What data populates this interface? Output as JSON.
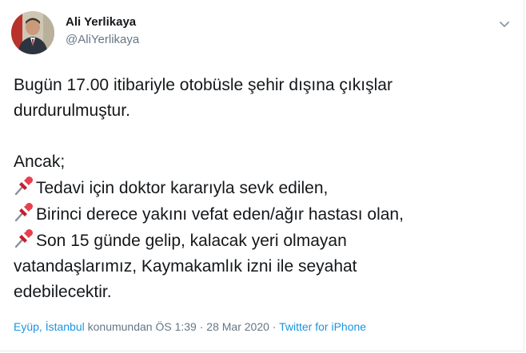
{
  "author": {
    "name": "Ali Yerlikaya",
    "handle": "@AliYerlikaya"
  },
  "tweet": {
    "line1": "Bugün 17.00 itibariyle otobüsle şehir dışına çıkışlar",
    "line2": "durdurulmuştur.",
    "line3": "Ancak;",
    "line4": "Tedavi için doktor kararıyla sevk edilen,",
    "line5": "Birinci derece yakını vefat eden/ağır hastası olan,",
    "line6": "Son 15 günde gelip, kalacak yeri olmayan",
    "line7": "vatandaşlarımız, Kaymakamlık izni ile seyahat",
    "line8": "edebilecektir."
  },
  "meta": {
    "location": "Eyüp, İstanbul",
    "location_suffix": " konumundan",
    "time": " ÖS 1:39",
    "sep1": " · ",
    "date": "28 Mar 2020",
    "sep2": " · ",
    "source": "Twitter for iPhone"
  },
  "icons": {
    "menu": "chevron-down-icon",
    "bullet": "pushpin-icon"
  },
  "colors": {
    "link": "#1b95e0",
    "secondary": "#657786",
    "text": "#14171a",
    "pin": "#d7263d"
  }
}
